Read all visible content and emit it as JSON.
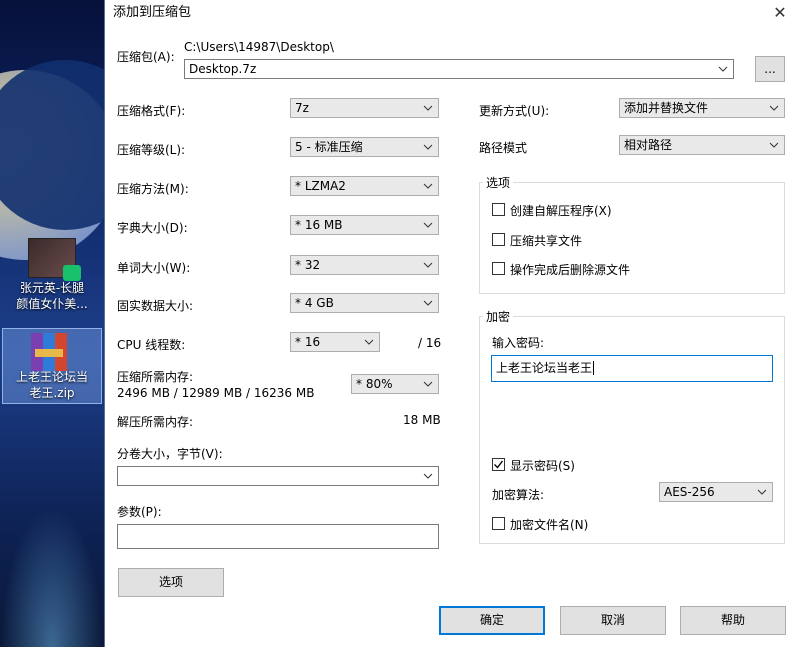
{
  "desktop": {
    "icons": [
      {
        "label_line1": "张元英-长腿",
        "label_line2": "颜值女仆美..."
      },
      {
        "label_line1": "上老王论坛当",
        "label_line2": "老王.zip"
      }
    ]
  },
  "dialog": {
    "title": "添加到压缩包",
    "archive_label": "压缩包(A):",
    "archive_path": "C:\\Users\\14987\\Desktop\\",
    "archive_name": "Desktop.7z",
    "browse_label": "...",
    "format_label": "压缩格式(F):",
    "format_value": "7z",
    "level_label": "压缩等级(L):",
    "level_value": "5 - 标准压缩",
    "method_label": "压缩方法(M):",
    "method_value": "* LZMA2",
    "dict_label": "字典大小(D):",
    "dict_value": "* 16 MB",
    "word_label": "单词大小(W):",
    "word_value": "* 32",
    "solid_label": "固实数据大小:",
    "solid_value": "* 4 GB",
    "threads_label": "CPU 线程数:",
    "threads_value": "* 16",
    "threads_max": "/ 16",
    "mem_label": "压缩所需内存:",
    "mem_value": "2496 MB / 12989 MB / 16236 MB",
    "mem_percent": "* 80%",
    "decomp_label": "解压所需内存:",
    "decomp_value": "18 MB",
    "split_label": "分卷大小，字节(V):",
    "split_value": "",
    "params_label": "参数(P):",
    "params_value": "",
    "options_button": "选项",
    "update_label": "更新方式(U):",
    "update_value": "添加并替换文件",
    "path_label": "路径模式",
    "path_value": "相对路径",
    "options_group": {
      "title": "选项",
      "sfx": "创建自解压程序(X)",
      "shared": "压缩共享文件",
      "delete": "操作完成后删除源文件"
    },
    "encryption": {
      "title": "加密",
      "password_label": "输入密码:",
      "password_value": "上老王论坛当老王",
      "show_password": "显示密码(S)",
      "method_label": "加密算法:",
      "method_value": "AES-256",
      "encrypt_names": "加密文件名(N)"
    },
    "ok_button": "确定",
    "cancel_button": "取消",
    "help_button": "帮助"
  }
}
